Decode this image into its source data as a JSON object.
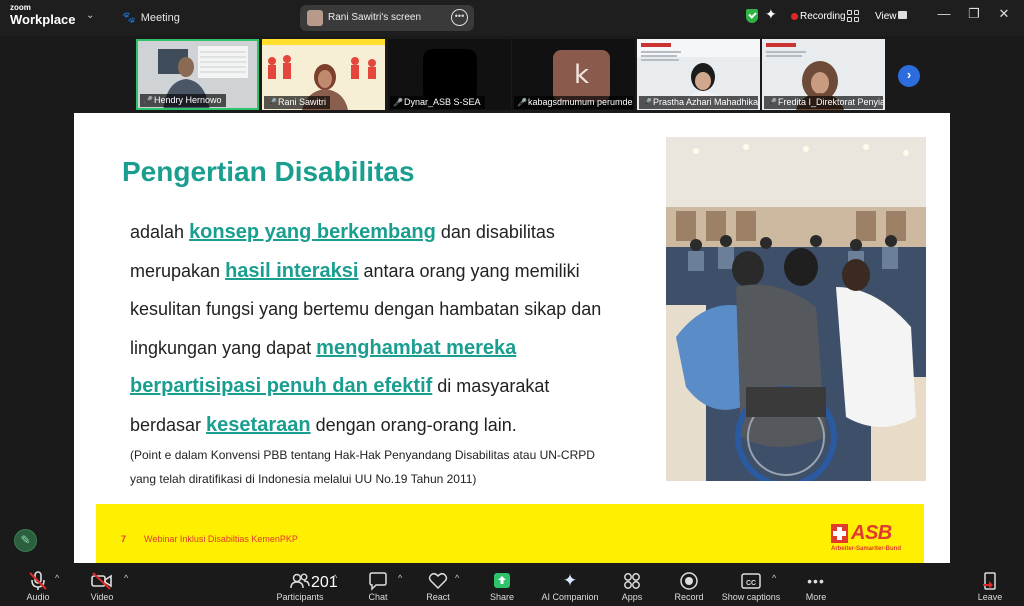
{
  "app": {
    "brand_small": "zoom",
    "brand_big": "Workplace",
    "meeting_label": "Meeting"
  },
  "share_tab": {
    "label": "Rani Sawitri's screen"
  },
  "topbar": {
    "recording_label": "Recording",
    "view_label": "View"
  },
  "participants_strip": [
    {
      "name": "Hendry Hernowo",
      "mic_muted": false
    },
    {
      "name": "Rani Sawitri",
      "mic_muted": false
    },
    {
      "name": "Dynar_ASB S-SEA",
      "mic_muted": true
    },
    {
      "name": "kabagsdmumum perumdes",
      "mic_muted": true,
      "avatar_letter": "k"
    },
    {
      "name": "Prastha Azhari Mahadhika_...",
      "mic_muted": true
    },
    {
      "name": "Fredita I_Direktorat Penyia...",
      "mic_muted": true
    }
  ],
  "slide": {
    "title": "Pengertian Disabilitas",
    "p1_a": "adalah ",
    "p1_hl": "konsep yang berkembang",
    "p1_b": " dan disabilitas",
    "p2_a": "merupakan ",
    "p2_hl": "hasil interaksi",
    "p2_b": " antara orang yang memiliki",
    "p3": "kesulitan fungsi yang bertemu dengan hambatan sikap dan",
    "p4_a": "lingkungan yang dapat ",
    "p4_hl": "menghambat mereka",
    "p5_hl": "berpartisipasi penuh dan efektif",
    "p5_b": " di masyarakat",
    "p6_a": "berdasar ",
    "p6_hl": "kesetaraan",
    "p6_b": " dengan orang-orang lain.",
    "note_1": "(Point e dalam Konvensi PBB tentang Hak-Hak Penyandang Disabilitas atau UN-CRPD",
    "note_2": "yang telah diratifikasi di Indonesia melalui UU No.19 Tahun 2011)",
    "footer_num": "7",
    "footer_text": "Webinar Inklusi Disabiltias KemenPKP",
    "logo_word": "ASB",
    "logo_sub": "Arbeiter-Samariter-Bund"
  },
  "toolbar": {
    "audio": "Audio",
    "video": "Video",
    "participants": "Participants",
    "participants_count": "201",
    "chat": "Chat",
    "react": "React",
    "share": "Share",
    "ai": "AI Companion",
    "apps": "Apps",
    "record": "Record",
    "captions": "Show captions",
    "more": "More",
    "leave": "Leave"
  },
  "colors": {
    "accent": "#1a9e8f",
    "share_green": "#2ec26a",
    "leave_red": "#e02828",
    "footer_yellow": "#ffef00",
    "asb_red": "#e23b2e"
  }
}
